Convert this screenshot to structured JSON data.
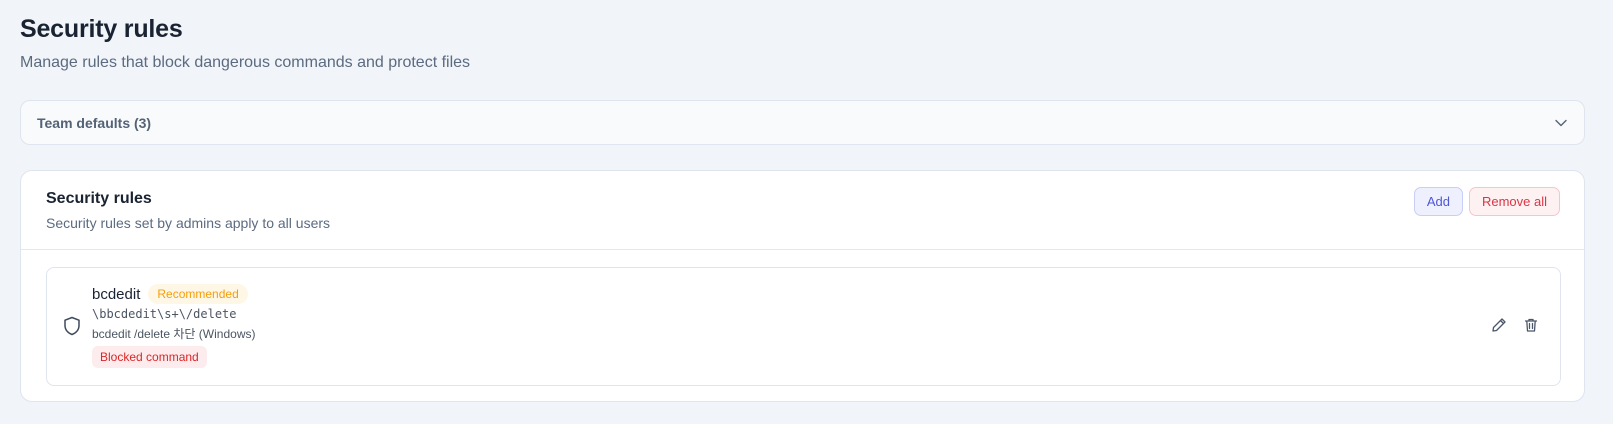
{
  "page": {
    "title": "Security rules",
    "subtitle": "Manage rules that block dangerous commands and protect files"
  },
  "defaults_panel": {
    "label": "Team defaults (3)",
    "icon": "chevron-down-icon"
  },
  "rules_card": {
    "title": "Security rules",
    "subtitle": "Security rules set by admins apply to all users",
    "add_label": "Add",
    "remove_all_label": "Remove all",
    "rules": [
      {
        "name": "bcdedit",
        "badge": "Recommended",
        "pattern": "\\bbcdedit\\s+\\/delete",
        "description": "bcdedit /delete 차단 (Windows)",
        "type": "Blocked command",
        "icon": "shield-icon"
      }
    ]
  },
  "colors": {
    "background": "#f1f4f9",
    "accent": "#4f56d6",
    "danger": "#dc2626",
    "warning": "#f59e0b"
  }
}
